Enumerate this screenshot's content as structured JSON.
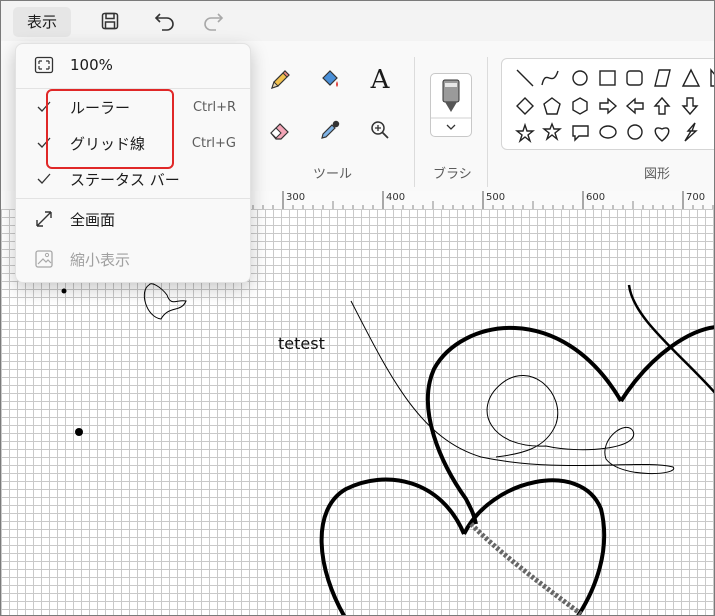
{
  "topbar": {
    "view_menu": "表示"
  },
  "ribbon": {
    "groups": {
      "tools": "ツール",
      "brushes": "ブラシ",
      "shapes": "図形"
    },
    "text_tool_glyph": "A"
  },
  "ruler": {
    "labels": [
      "300",
      "400",
      "500",
      "600",
      "700"
    ]
  },
  "canvas": {
    "text": "tetest"
  },
  "view_menu": {
    "items": [
      {
        "label": "100%",
        "shortcut": "",
        "checked": false,
        "icon": "fit-screen-icon"
      },
      {
        "label": "ルーラー",
        "shortcut": "Ctrl+R",
        "checked": true,
        "icon": "check-icon"
      },
      {
        "label": "グリッド線",
        "shortcut": "Ctrl+G",
        "checked": true,
        "icon": "check-icon"
      },
      {
        "label": "ステータス バー",
        "shortcut": "",
        "checked": true,
        "icon": "check-icon"
      },
      {
        "label": "全画面",
        "shortcut": "",
        "checked": false,
        "icon": "fullscreen-icon"
      },
      {
        "label": "縮小表示",
        "shortcut": "",
        "checked": false,
        "icon": "thumbnail-icon",
        "disabled": true
      }
    ]
  },
  "colors": {
    "highlight": "#e02828",
    "accent": "#0067c0"
  }
}
